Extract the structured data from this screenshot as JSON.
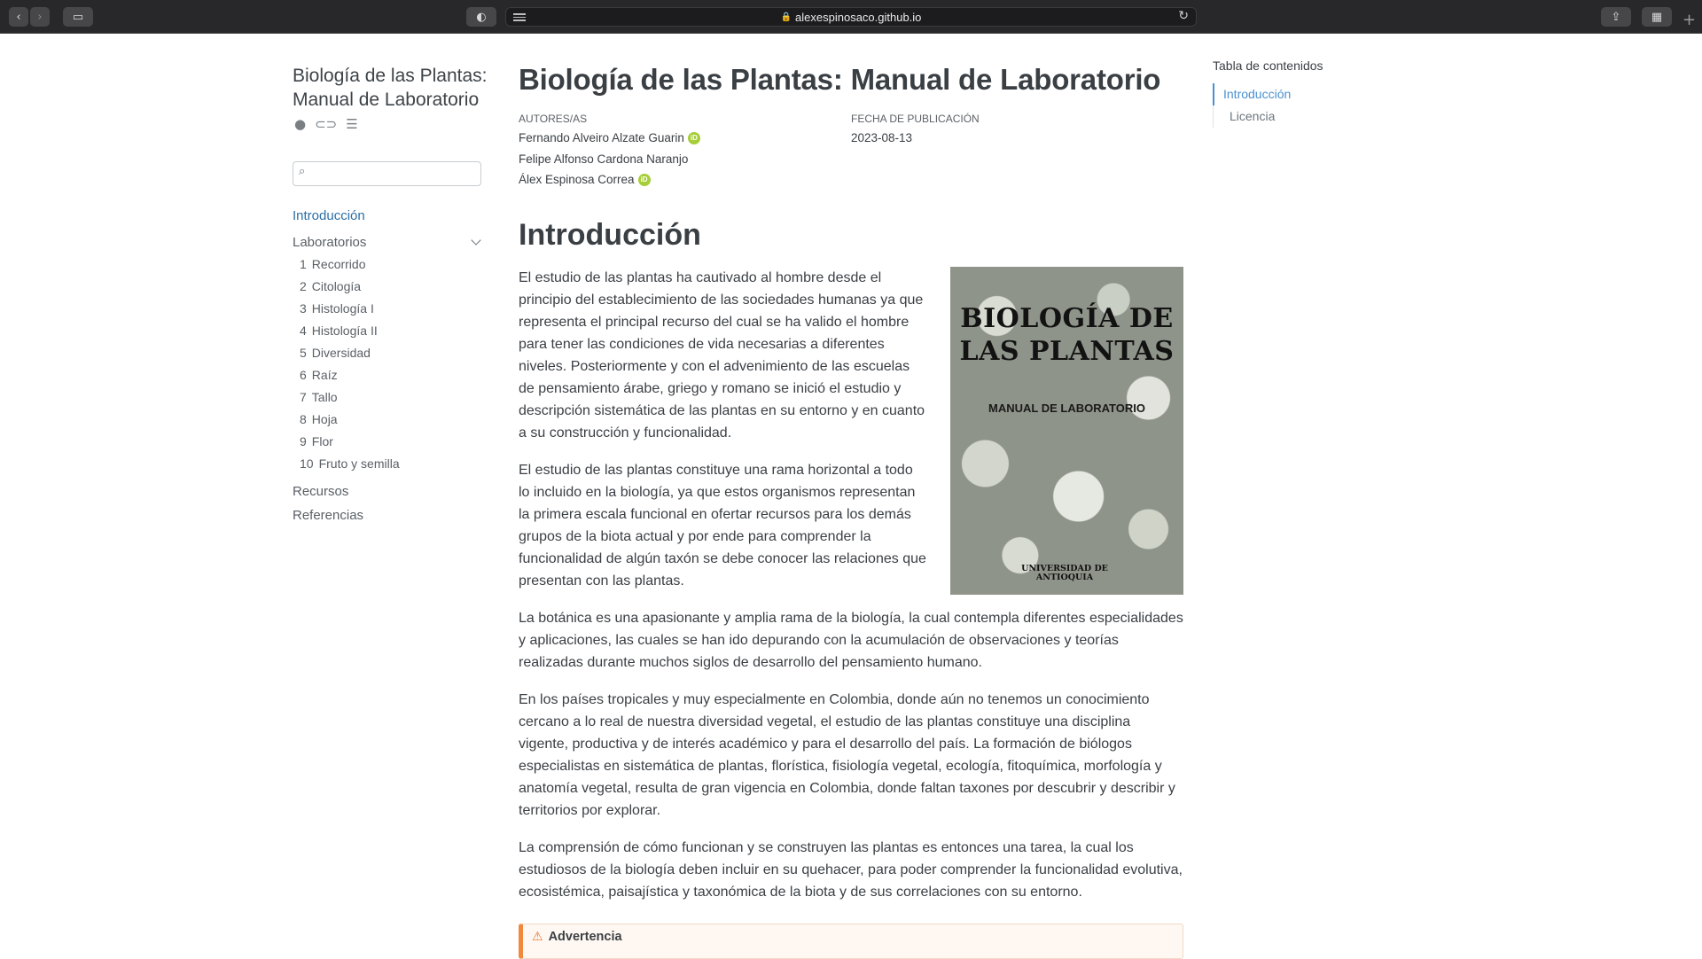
{
  "browser": {
    "url": "alexespinosaco.github.io"
  },
  "sidebar": {
    "site_title": "Biología de las Plantas: Manual de Laboratorio",
    "icons": [
      "github-icon",
      "toggle-icon",
      "reader-mode-icon"
    ],
    "search_placeholder": "",
    "nav": {
      "intro": "Introducción",
      "labs_label": "Laboratorios",
      "labs": [
        {
          "num": "1",
          "label": "Recorrido"
        },
        {
          "num": "2",
          "label": "Citología"
        },
        {
          "num": "3",
          "label": "Histología I"
        },
        {
          "num": "4",
          "label": "Histología II"
        },
        {
          "num": "5",
          "label": "Diversidad"
        },
        {
          "num": "6",
          "label": "Raíz"
        },
        {
          "num": "7",
          "label": "Tallo"
        },
        {
          "num": "8",
          "label": "Hoja"
        },
        {
          "num": "9",
          "label": "Flor"
        },
        {
          "num": "10",
          "label": "Fruto y semilla"
        }
      ],
      "resources": "Recursos",
      "references": "Referencias"
    }
  },
  "main": {
    "title": "Biología de las Plantas: Manual de Laboratorio",
    "authors_label": "AUTORES/AS",
    "authors": [
      {
        "name": "Fernando Alveiro Alzate Guarin",
        "orcid": true
      },
      {
        "name": "Felipe Alfonso Cardona Naranjo",
        "orcid": false
      },
      {
        "name": "Álex Espinosa Correa",
        "orcid": true
      }
    ],
    "date_label": "FECHA DE PUBLICACIÓN",
    "date": "2023-08-13",
    "section_title": "Introducción",
    "cover": {
      "title": "BIOLOGÍA DE LAS PLANTAS",
      "subtitle": "MANUAL DE LABORATORIO",
      "university": "UNIVERSIDAD DE ANTIOQUIA"
    },
    "paragraphs": [
      "El estudio de las plantas ha cautivado al hombre desde el principio del establecimiento de las sociedades humanas ya que representa el principal recurso del cual se ha valido el hombre para tener las condiciones de vida necesarias a diferentes niveles. Posteriormente y con el advenimiento de las escuelas de pensamiento árabe, griego y romano se inició el estudio y descripción sistemática de las plantas en su entorno y en cuanto a su construcción y funcionalidad.",
      "El estudio de las plantas constituye una rama horizontal a todo lo incluido en la biología, ya que estos organismos representan la primera escala funcional en ofertar recursos para los demás grupos de la biota actual y por ende para comprender la funcionalidad de algún taxón se debe conocer las relaciones que presentan con las plantas.",
      "La botánica es una apasionante y amplia rama de la biología, la cual contempla diferentes especialidades y aplicaciones, las cuales se han ido depurando con la acumulación de observaciones y teorías realizadas durante muchos siglos de desarrollo del pensamiento humano.",
      "En los países tropicales y muy especialmente en Colombia, donde aún no tenemos un conocimiento cercano a lo real de nuestra diversidad vegetal, el estudio de las plantas constituye una disciplina vigente, productiva y de interés académico y para el desarrollo del país. La formación de biólogos especialistas en sistemática de plantas, florística, fisiología vegetal, ecología, fitoquímica, morfología y anatomía vegetal, resulta de gran vigencia en Colombia, donde faltan taxones por descubrir y describir y territorios por explorar.",
      "La comprensión de cómo funcionan y se construyen las plantas es entonces una tarea, la cual los estudiosos de la biología deben incluir en su quehacer, para poder comprender la funcionalidad evolutiva, ecosistémica, paisajística y taxonómica de la biota y de sus correlaciones con su entorno."
    ],
    "callout_title": "Advertencia"
  },
  "toc": {
    "title": "Tabla de contenidos",
    "items": [
      {
        "label": "Introducción",
        "active": true
      },
      {
        "label": "Licencia",
        "active": false
      }
    ]
  }
}
